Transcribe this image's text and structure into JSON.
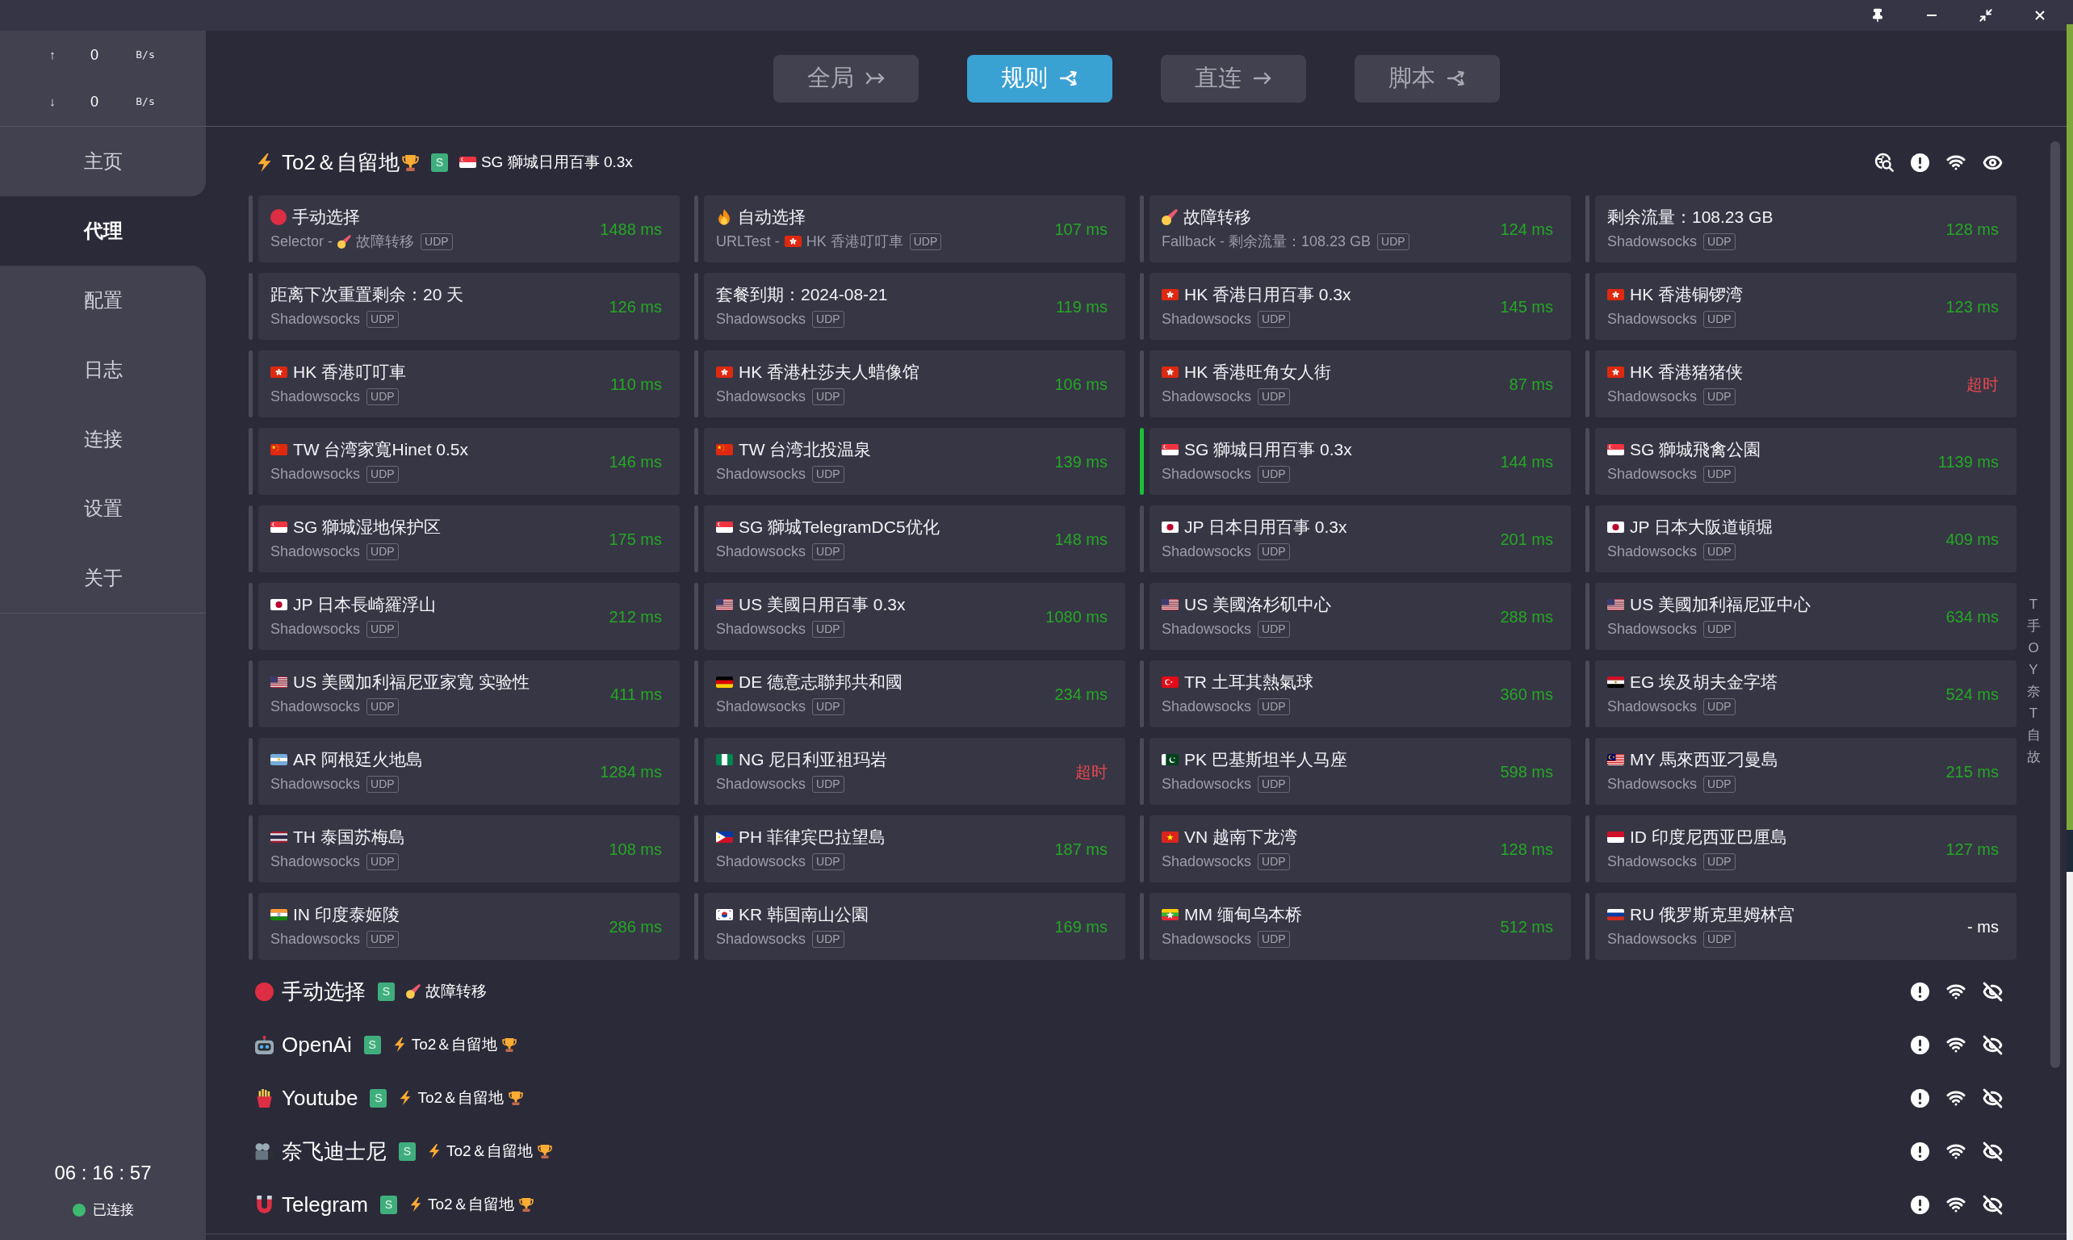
{
  "traffic": [
    {
      "arrow": "↑",
      "value": "0",
      "unit": "B/s"
    },
    {
      "arrow": "↓",
      "value": "0",
      "unit": "B/s"
    }
  ],
  "nav": [
    {
      "label": "主页",
      "selected": false
    },
    {
      "label": "代理",
      "selected": true
    },
    {
      "label": "配置",
      "selected": false
    },
    {
      "label": "日志",
      "selected": false
    },
    {
      "label": "连接",
      "selected": false
    },
    {
      "label": "设置",
      "selected": false
    },
    {
      "label": "关于",
      "selected": false
    }
  ],
  "clock": "06 : 16 : 57",
  "connection": {
    "label": "已连接",
    "connected": true
  },
  "modes": [
    {
      "label": "全局",
      "kind": "global",
      "selected": false
    },
    {
      "label": "规则",
      "kind": "rule",
      "selected": true
    },
    {
      "label": "直连",
      "kind": "direct",
      "selected": false
    },
    {
      "label": "脚本",
      "kind": "script",
      "selected": false
    }
  ],
  "groups": [
    {
      "kind": "lightning",
      "name": "To2＆自留地",
      "trophy": true,
      "badge": "S",
      "current": {
        "kind": "sg",
        "name": "SG 獅城日用百事 0.3x",
        "trophy": false
      },
      "expanded": true,
      "proxies": [
        {
          "kind": "dot",
          "name": "手动选择",
          "type": "Selector -",
          "via": {
            "kind": "comet",
            "name": "故障转移"
          },
          "udp": "UDP",
          "delay": {
            "kind": "ok",
            "text": "1488 ms"
          },
          "selected": false
        },
        {
          "kind": "fire",
          "name": "自动选择",
          "type": "URLTest -",
          "via": {
            "kind": "hk",
            "name": "HK 香港叮叮車"
          },
          "udp": "UDP",
          "delay": {
            "kind": "ok",
            "text": "107 ms"
          },
          "selected": false
        },
        {
          "kind": "comet",
          "name": "故障转移",
          "type": "Fallback - 剩余流量：108.23 GB",
          "udp": "UDP",
          "delay": {
            "kind": "ok",
            "text": "124 ms"
          },
          "selected": false
        },
        {
          "kind": "plain",
          "name": "剩余流量：108.23 GB",
          "type": "Shadowsocks",
          "udp": "UDP",
          "delay": {
            "kind": "ok",
            "text": "128 ms"
          },
          "selected": false
        },
        {
          "kind": "plain",
          "name": "距离下次重置剩余：20 天",
          "type": "Shadowsocks",
          "udp": "UDP",
          "delay": {
            "kind": "ok",
            "text": "126 ms"
          },
          "selected": false
        },
        {
          "kind": "plain",
          "name": "套餐到期：2024-08-21",
          "type": "Shadowsocks",
          "udp": "UDP",
          "delay": {
            "kind": "ok",
            "text": "119 ms"
          },
          "selected": false
        },
        {
          "kind": "hk",
          "name": "HK 香港日用百事 0.3x",
          "type": "Shadowsocks",
          "udp": "UDP",
          "delay": {
            "kind": "ok",
            "text": "145 ms"
          },
          "selected": false
        },
        {
          "kind": "hk",
          "name": "HK 香港铜锣湾",
          "type": "Shadowsocks",
          "udp": "UDP",
          "delay": {
            "kind": "ok",
            "text": "123 ms"
          },
          "selected": false
        },
        {
          "kind": "hk",
          "name": "HK 香港叮叮車",
          "type": "Shadowsocks",
          "udp": "UDP",
          "delay": {
            "kind": "ok",
            "text": "110 ms"
          },
          "selected": false
        },
        {
          "kind": "hk",
          "name": "HK 香港杜莎夫人蜡像馆",
          "type": "Shadowsocks",
          "udp": "UDP",
          "delay": {
            "kind": "ok",
            "text": "106 ms"
          },
          "selected": false
        },
        {
          "kind": "hk",
          "name": "HK 香港旺角女人街",
          "type": "Shadowsocks",
          "udp": "UDP",
          "delay": {
            "kind": "ok",
            "text": "87 ms"
          },
          "selected": false
        },
        {
          "kind": "hk",
          "name": "HK 香港猪猪侠",
          "type": "Shadowsocks",
          "udp": "UDP",
          "delay": {
            "kind": "timeout",
            "text": "超时"
          },
          "selected": false
        },
        {
          "kind": "cn",
          "name": "TW 台湾家寬Hinet 0.5x",
          "type": "Shadowsocks",
          "udp": "UDP",
          "delay": {
            "kind": "ok",
            "text": "146 ms"
          },
          "selected": false
        },
        {
          "kind": "cn",
          "name": "TW 台湾北投温泉",
          "type": "Shadowsocks",
          "udp": "UDP",
          "delay": {
            "kind": "ok",
            "text": "139 ms"
          },
          "selected": false
        },
        {
          "kind": "sg",
          "name": "SG 獅城日用百事 0.3x",
          "type": "Shadowsocks",
          "udp": "UDP",
          "delay": {
            "kind": "ok",
            "text": "144 ms"
          },
          "selected": true
        },
        {
          "kind": "sg",
          "name": "SG 獅城飛禽公園",
          "type": "Shadowsocks",
          "udp": "UDP",
          "delay": {
            "kind": "ok",
            "text": "1139 ms"
          },
          "selected": false
        },
        {
          "kind": "sg",
          "name": "SG 獅城湿地保护区",
          "type": "Shadowsocks",
          "udp": "UDP",
          "delay": {
            "kind": "ok",
            "text": "175 ms"
          },
          "selected": false
        },
        {
          "kind": "sg",
          "name": "SG 獅城TelegramDC5优化",
          "type": "Shadowsocks",
          "udp": "UDP",
          "delay": {
            "kind": "ok",
            "text": "148 ms"
          },
          "selected": false
        },
        {
          "kind": "jp",
          "name": "JP 日本日用百事 0.3x",
          "type": "Shadowsocks",
          "udp": "UDP",
          "delay": {
            "kind": "ok",
            "text": "201 ms"
          },
          "selected": false
        },
        {
          "kind": "jp",
          "name": "JP 日本大阪道頓堀",
          "type": "Shadowsocks",
          "udp": "UDP",
          "delay": {
            "kind": "ok",
            "text": "409 ms"
          },
          "selected": false
        },
        {
          "kind": "jp",
          "name": "JP 日本長崎羅浮山",
          "type": "Shadowsocks",
          "udp": "UDP",
          "delay": {
            "kind": "ok",
            "text": "212 ms"
          },
          "selected": false
        },
        {
          "kind": "us",
          "name": "US 美國日用百事 0.3x",
          "type": "Shadowsocks",
          "udp": "UDP",
          "delay": {
            "kind": "ok",
            "text": "1080 ms"
          },
          "selected": false
        },
        {
          "kind": "us",
          "name": "US 美國洛杉矶中心",
          "type": "Shadowsocks",
          "udp": "UDP",
          "delay": {
            "kind": "ok",
            "text": "288 ms"
          },
          "selected": false
        },
        {
          "kind": "us",
          "name": "US 美國加利福尼亚中心",
          "type": "Shadowsocks",
          "udp": "UDP",
          "delay": {
            "kind": "ok",
            "text": "634 ms"
          },
          "selected": false
        },
        {
          "kind": "us",
          "name": "US 美國加利福尼亚家寬 实验性",
          "type": "Shadowsocks",
          "udp": "UDP",
          "delay": {
            "kind": "ok",
            "text": "411 ms"
          },
          "selected": false
        },
        {
          "kind": "de",
          "name": "DE 德意志聯邦共和國",
          "type": "Shadowsocks",
          "udp": "UDP",
          "delay": {
            "kind": "ok",
            "text": "234 ms"
          },
          "selected": false
        },
        {
          "kind": "tr",
          "name": "TR 土耳其熱氣球",
          "type": "Shadowsocks",
          "udp": "UDP",
          "delay": {
            "kind": "ok",
            "text": "360 ms"
          },
          "selected": false
        },
        {
          "kind": "eg",
          "name": "EG 埃及胡夫金字塔",
          "type": "Shadowsocks",
          "udp": "UDP",
          "delay": {
            "kind": "ok",
            "text": "524 ms"
          },
          "selected": false
        },
        {
          "kind": "ar",
          "name": "AR 阿根廷火地島",
          "type": "Shadowsocks",
          "udp": "UDP",
          "delay": {
            "kind": "ok",
            "text": "1284 ms"
          },
          "selected": false
        },
        {
          "kind": "ng",
          "name": "NG 尼日利亚祖玛岩",
          "type": "Shadowsocks",
          "udp": "UDP",
          "delay": {
            "kind": "timeout",
            "text": "超时"
          },
          "selected": false
        },
        {
          "kind": "pk",
          "name": "PK 巴基斯坦半人马座",
          "type": "Shadowsocks",
          "udp": "UDP",
          "delay": {
            "kind": "ok",
            "text": "598 ms"
          },
          "selected": false
        },
        {
          "kind": "my",
          "name": "MY 馬來西亚刁曼島",
          "type": "Shadowsocks",
          "udp": "UDP",
          "delay": {
            "kind": "ok",
            "text": "215 ms"
          },
          "selected": false
        },
        {
          "kind": "th",
          "name": "TH 泰国苏梅島",
          "type": "Shadowsocks",
          "udp": "UDP",
          "delay": {
            "kind": "ok",
            "text": "108 ms"
          },
          "selected": false
        },
        {
          "kind": "ph",
          "name": "PH 菲律宾巴拉望島",
          "type": "Shadowsocks",
          "udp": "UDP",
          "delay": {
            "kind": "ok",
            "text": "187 ms"
          },
          "selected": false
        },
        {
          "kind": "vn",
          "name": "VN 越南下龙湾",
          "type": "Shadowsocks",
          "udp": "UDP",
          "delay": {
            "kind": "ok",
            "text": "128 ms"
          },
          "selected": false
        },
        {
          "kind": "id",
          "name": "ID 印度尼西亚巴厘島",
          "type": "Shadowsocks",
          "udp": "UDP",
          "delay": {
            "kind": "ok",
            "text": "127 ms"
          },
          "selected": false
        },
        {
          "kind": "in",
          "name": "IN 印度泰姬陵",
          "type": "Shadowsocks",
          "udp": "UDP",
          "delay": {
            "kind": "ok",
            "text": "286 ms"
          },
          "selected": false
        },
        {
          "kind": "kr",
          "name": "KR 韩国南山公園",
          "type": "Shadowsocks",
          "udp": "UDP",
          "delay": {
            "kind": "ok",
            "text": "169 ms"
          },
          "selected": false
        },
        {
          "kind": "mm",
          "name": "MM 缅甸乌本桥",
          "type": "Shadowsocks",
          "udp": "UDP",
          "delay": {
            "kind": "ok",
            "text": "512 ms"
          },
          "selected": false
        },
        {
          "kind": "ru",
          "name": "RU 俄罗斯克里姆林宫",
          "type": "Shadowsocks",
          "udp": "UDP",
          "delay": {
            "kind": "untested",
            "text": "- ms"
          },
          "selected": false
        }
      ]
    },
    {
      "kind": "dot",
      "name": "手动选择",
      "trophy": false,
      "badge": "S",
      "current": {
        "kind": "comet",
        "name": "故障转移",
        "trophy": false
      },
      "expanded": false
    },
    {
      "kind": "robot",
      "name": "OpenAi",
      "trophy": false,
      "badge": "S",
      "current": {
        "kind": "lightning",
        "name": "To2＆自留地",
        "trophy": true
      },
      "expanded": false
    },
    {
      "kind": "fries",
      "name": "Youtube",
      "trophy": false,
      "badge": "S",
      "current": {
        "kind": "lightning",
        "name": "To2＆自留地",
        "trophy": true
      },
      "expanded": false
    },
    {
      "kind": "camera",
      "name": "奈飞迪士尼",
      "trophy": false,
      "badge": "S",
      "current": {
        "kind": "lightning",
        "name": "To2＆自留地",
        "trophy": true
      },
      "expanded": false
    },
    {
      "kind": "magnet",
      "name": "Telegram",
      "trophy": false,
      "badge": "S",
      "current": {
        "kind": "lightning",
        "name": "To2＆自留地",
        "trophy": true
      },
      "expanded": false
    }
  ],
  "index_letters": [
    "T",
    "手",
    "O",
    "Y",
    "奈",
    "T",
    "自",
    "故"
  ]
}
